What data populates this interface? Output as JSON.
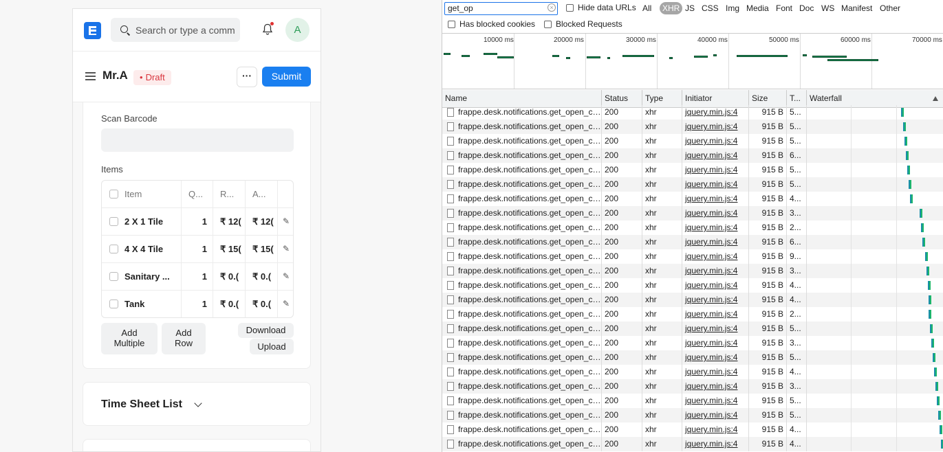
{
  "app": {
    "search_placeholder": "Search or type a comm",
    "avatar_initial": "A",
    "title": "Mr.A",
    "status_badge": "Draft",
    "more_label": "···",
    "submit_label": "Submit",
    "scan_barcode_label": "Scan Barcode",
    "items_label": "Items",
    "grid_headers": {
      "item": "Item",
      "qty": "Q...",
      "rate": "R...",
      "amount": "A..."
    },
    "grid_rows": [
      {
        "item": "2 X 1 Tile",
        "qty": "1",
        "rate": "₹ 12(",
        "amount": "₹ 12("
      },
      {
        "item": "4 X 4 Tile",
        "qty": "1",
        "rate": "₹ 15(",
        "amount": "₹ 15("
      },
      {
        "item": "Sanitary ...",
        "qty": "1",
        "rate": "₹ 0.(",
        "amount": "₹ 0.("
      },
      {
        "item": "Tank",
        "qty": "1",
        "rate": "₹ 0.(",
        "amount": "₹ 0.("
      }
    ],
    "add_multiple_line1": "Add",
    "add_multiple_line2": "Multiple",
    "add_row_line1": "Add",
    "add_row_line2": "Row",
    "download_label": "Download",
    "upload_label": "Upload",
    "time_sheet_title": "Time Sheet List",
    "colors": {
      "primary": "#1a7ff0",
      "draft": "#d9363e"
    }
  },
  "devtools": {
    "filter_value": "get_op",
    "hide_data_urls": "Hide data URLs",
    "type_filters": [
      "All",
      "XHR",
      "JS",
      "CSS",
      "Img",
      "Media",
      "Font",
      "Doc",
      "WS",
      "Manifest",
      "Other"
    ],
    "active_type": "XHR",
    "has_blocked_cookies": "Has blocked cookies",
    "blocked_requests": "Blocked Requests",
    "overview_ticks": [
      "10000 ms",
      "20000 ms",
      "30000 ms",
      "40000 ms",
      "50000 ms",
      "60000 ms",
      "70000 ms"
    ],
    "columns": {
      "name": "Name",
      "status": "Status",
      "type": "Type",
      "initiator": "Initiator",
      "size": "Size",
      "time": "T...",
      "waterfall": "Waterfall"
    },
    "requests": [
      {
        "name": "frappe.desk.notifications.get_open_count",
        "status": "200",
        "type": "xhr",
        "initiator": "jquery.min.js:4",
        "size": "915 B",
        "time": "5...",
        "wf": 0.7
      },
      {
        "name": "frappe.desk.notifications.get_open_count",
        "status": "200",
        "type": "xhr",
        "initiator": "jquery.min.js:4",
        "size": "915 B",
        "time": "5...",
        "wf": 0.72
      },
      {
        "name": "frappe.desk.notifications.get_open_count",
        "status": "200",
        "type": "xhr",
        "initiator": "jquery.min.js:4",
        "size": "915 B",
        "time": "5...",
        "wf": 0.73
      },
      {
        "name": "frappe.desk.notifications.get_open_count",
        "status": "200",
        "type": "xhr",
        "initiator": "jquery.min.js:4",
        "size": "915 B",
        "time": "6...",
        "wf": 0.74
      },
      {
        "name": "frappe.desk.notifications.get_open_count",
        "status": "200",
        "type": "xhr",
        "initiator": "jquery.min.js:4",
        "size": "915 B",
        "time": "5...",
        "wf": 0.75
      },
      {
        "name": "frappe.desk.notifications.get_open_count",
        "status": "200",
        "type": "xhr",
        "initiator": "jquery.min.js:4",
        "size": "915 B",
        "time": "5...",
        "wf": 0.76
      },
      {
        "name": "frappe.desk.notifications.get_open_count",
        "status": "200",
        "type": "xhr",
        "initiator": "jquery.min.js:4",
        "size": "915 B",
        "time": "4...",
        "wf": 0.77
      },
      {
        "name": "frappe.desk.notifications.get_open_count",
        "status": "200",
        "type": "xhr",
        "initiator": "jquery.min.js:4",
        "size": "915 B",
        "time": "3...",
        "wf": 0.84
      },
      {
        "name": "frappe.desk.notifications.get_open_count",
        "status": "200",
        "type": "xhr",
        "initiator": "jquery.min.js:4",
        "size": "915 B",
        "time": "2...",
        "wf": 0.85
      },
      {
        "name": "frappe.desk.notifications.get_open_count",
        "status": "200",
        "type": "xhr",
        "initiator": "jquery.min.js:4",
        "size": "915 B",
        "time": "6...",
        "wf": 0.86
      },
      {
        "name": "frappe.desk.notifications.get_open_count",
        "status": "200",
        "type": "xhr",
        "initiator": "jquery.min.js:4",
        "size": "915 B",
        "time": "9...",
        "wf": 0.88
      },
      {
        "name": "frappe.desk.notifications.get_open_count",
        "status": "200",
        "type": "xhr",
        "initiator": "jquery.min.js:4",
        "size": "915 B",
        "time": "3...",
        "wf": 0.89
      },
      {
        "name": "frappe.desk.notifications.get_open_count",
        "status": "200",
        "type": "xhr",
        "initiator": "jquery.min.js:4",
        "size": "915 B",
        "time": "4...",
        "wf": 0.9
      },
      {
        "name": "frappe.desk.notifications.get_open_count",
        "status": "200",
        "type": "xhr",
        "initiator": "jquery.min.js:4",
        "size": "915 B",
        "time": "4...",
        "wf": 0.91
      },
      {
        "name": "frappe.desk.notifications.get_open_count",
        "status": "200",
        "type": "xhr",
        "initiator": "jquery.min.js:4",
        "size": "915 B",
        "time": "2...",
        "wf": 0.91
      },
      {
        "name": "frappe.desk.notifications.get_open_count",
        "status": "200",
        "type": "xhr",
        "initiator": "jquery.min.js:4",
        "size": "915 B",
        "time": "5...",
        "wf": 0.92
      },
      {
        "name": "frappe.desk.notifications.get_open_count",
        "status": "200",
        "type": "xhr",
        "initiator": "jquery.min.js:4",
        "size": "915 B",
        "time": "3...",
        "wf": 0.93
      },
      {
        "name": "frappe.desk.notifications.get_open_count",
        "status": "200",
        "type": "xhr",
        "initiator": "jquery.min.js:4",
        "size": "915 B",
        "time": "5...",
        "wf": 0.94
      },
      {
        "name": "frappe.desk.notifications.get_open_count",
        "status": "200",
        "type": "xhr",
        "initiator": "jquery.min.js:4",
        "size": "915 B",
        "time": "4...",
        "wf": 0.95
      },
      {
        "name": "frappe.desk.notifications.get_open_count",
        "status": "200",
        "type": "xhr",
        "initiator": "jquery.min.js:4",
        "size": "915 B",
        "time": "3...",
        "wf": 0.96
      },
      {
        "name": "frappe.desk.notifications.get_open_count",
        "status": "200",
        "type": "xhr",
        "initiator": "jquery.min.js:4",
        "size": "915 B",
        "time": "5...",
        "wf": 0.97
      },
      {
        "name": "frappe.desk.notifications.get_open_count",
        "status": "200",
        "type": "xhr",
        "initiator": "jquery.min.js:4",
        "size": "915 B",
        "time": "5...",
        "wf": 0.98
      },
      {
        "name": "frappe.desk.notifications.get_open_count",
        "status": "200",
        "type": "xhr",
        "initiator": "jquery.min.js:4",
        "size": "915 B",
        "time": "4...",
        "wf": 0.99
      },
      {
        "name": "frappe.desk.notifications.get_open_count",
        "status": "200",
        "type": "xhr",
        "initiator": "jquery.min.js:4",
        "size": "915 B",
        "time": "4...",
        "wf": 1.0
      }
    ]
  }
}
